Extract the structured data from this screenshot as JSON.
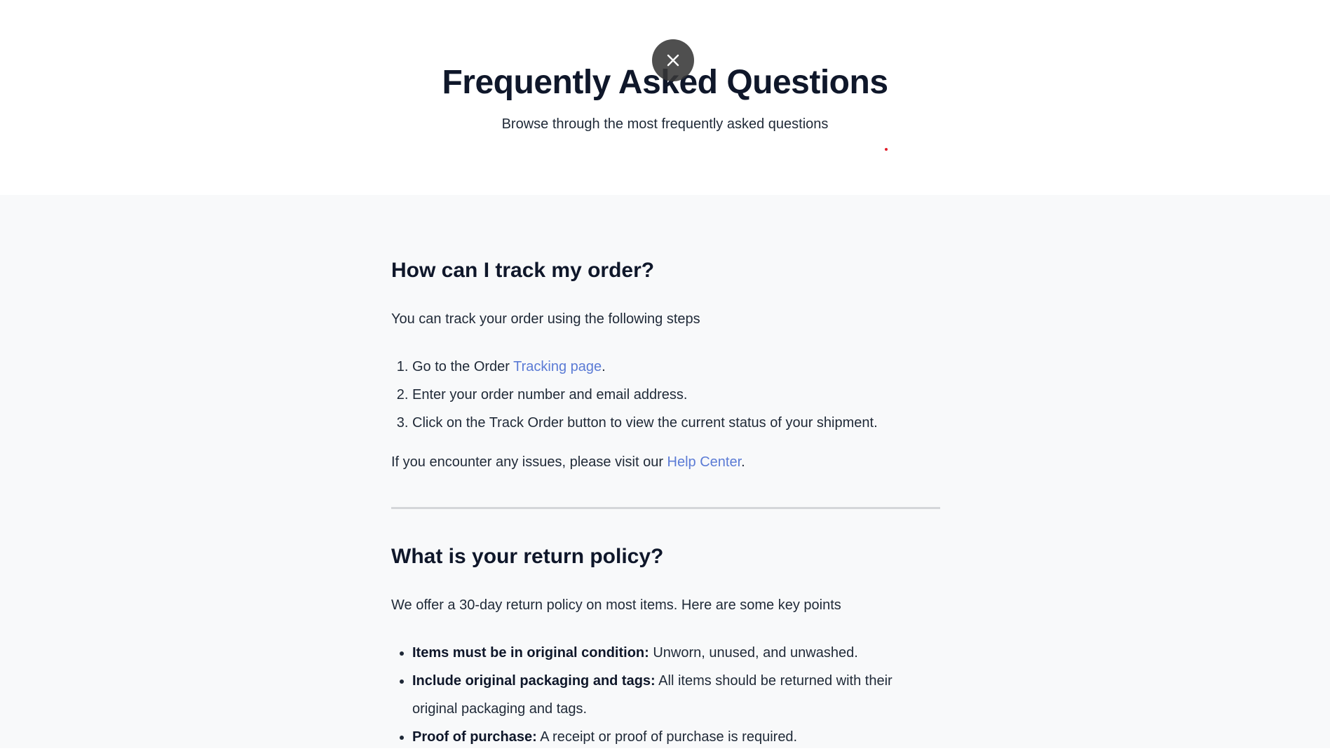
{
  "hero": {
    "title": "Frequently Asked Questions",
    "subtitle": "Browse through the most frequently asked questions",
    "close_icon": "close-icon"
  },
  "faqs": [
    {
      "question": "How can I track my order?",
      "intro": "You can track your order using the following steps",
      "steps": [
        {
          "prefix": "Go to the Order ",
          "link": "Tracking page",
          "suffix": "."
        },
        {
          "text": "Enter your order number and email address."
        },
        {
          "text": "Click on the Track Order button to view the current status of your shipment."
        }
      ],
      "outro": {
        "prefix": "If you encounter any issues, please visit our ",
        "link": "Help Center",
        "suffix": "."
      }
    },
    {
      "question": "What is your return policy?",
      "intro": "We offer a 30-day return policy on most items. Here are some key points",
      "points": [
        {
          "bold": "Items must be in original condition:",
          "text": " Unworn, unused, and unwashed."
        },
        {
          "bold": "Include original packaging and tags:",
          "text": " All items should be returned with their original packaging and tags."
        },
        {
          "bold": "Proof of purchase:",
          "text": " A receipt or proof of purchase is required."
        }
      ]
    }
  ],
  "colors": {
    "link": "#5b7bd5",
    "section_background": "#f8f9fa",
    "close_button": "#373737"
  }
}
